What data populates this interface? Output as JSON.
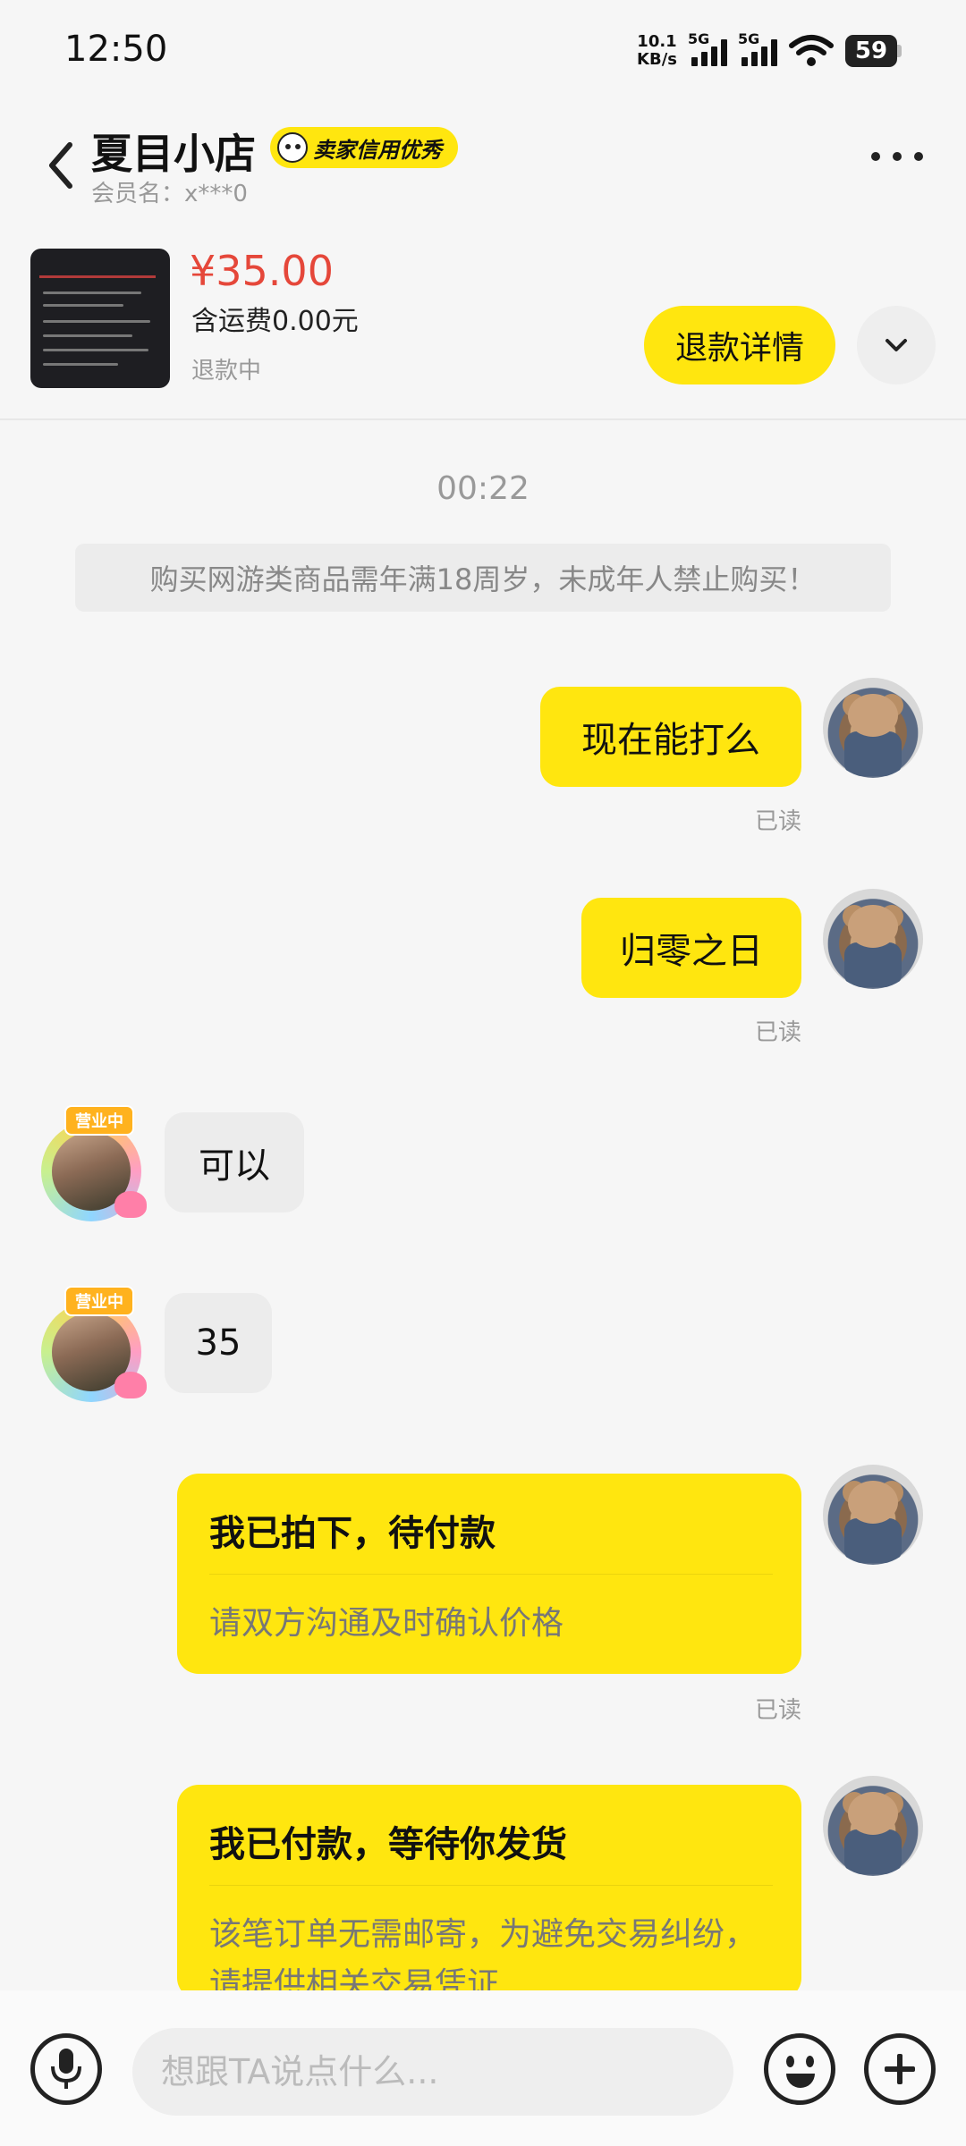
{
  "status_bar": {
    "time": "12:50",
    "speed_value": "10.1",
    "speed_unit": "KB/s",
    "signal1_label": "5G",
    "signal2_label": "5G",
    "battery": "59"
  },
  "header": {
    "shop_name": "夏目小店",
    "credit_badge": "卖家信用优秀",
    "member_name": "会员名：x***0"
  },
  "product": {
    "price": "¥35.00",
    "shipping": "含运费0.00元",
    "status": "退款中",
    "refund_button": "退款详情"
  },
  "chat": {
    "timestamp": "00:22",
    "notice": "购买网游类商品需年满18周岁，未成年人禁止购买！",
    "messages": [
      {
        "from": "me",
        "text": "现在能打么",
        "status": "已读"
      },
      {
        "from": "me",
        "text": "归零之日",
        "status": "已读"
      },
      {
        "from": "shop",
        "text": "可以"
      },
      {
        "from": "shop",
        "text": "35"
      }
    ],
    "shop_avatar_sign": "营业中",
    "cards": [
      {
        "title": "我已拍下，待付款",
        "desc": "请双方沟通及时确认价格",
        "status": "已读"
      },
      {
        "title": "我已付款，等待你发货",
        "desc": "该笔订单无需邮寄，为避免交易纠纷，请提供相关交易凭证"
      }
    ]
  },
  "input_bar": {
    "placeholder": "想跟TA说点什么..."
  },
  "icons": {
    "back": "back-arrow-icon",
    "more": "more-dots-icon",
    "expand": "chevron-down-icon",
    "mic": "microphone-icon",
    "emoji": "emoji-icon",
    "plus": "plus-icon"
  },
  "colors": {
    "accent": "#ffe60f",
    "price": "#e5473a",
    "background": "#f6f6f6"
  }
}
